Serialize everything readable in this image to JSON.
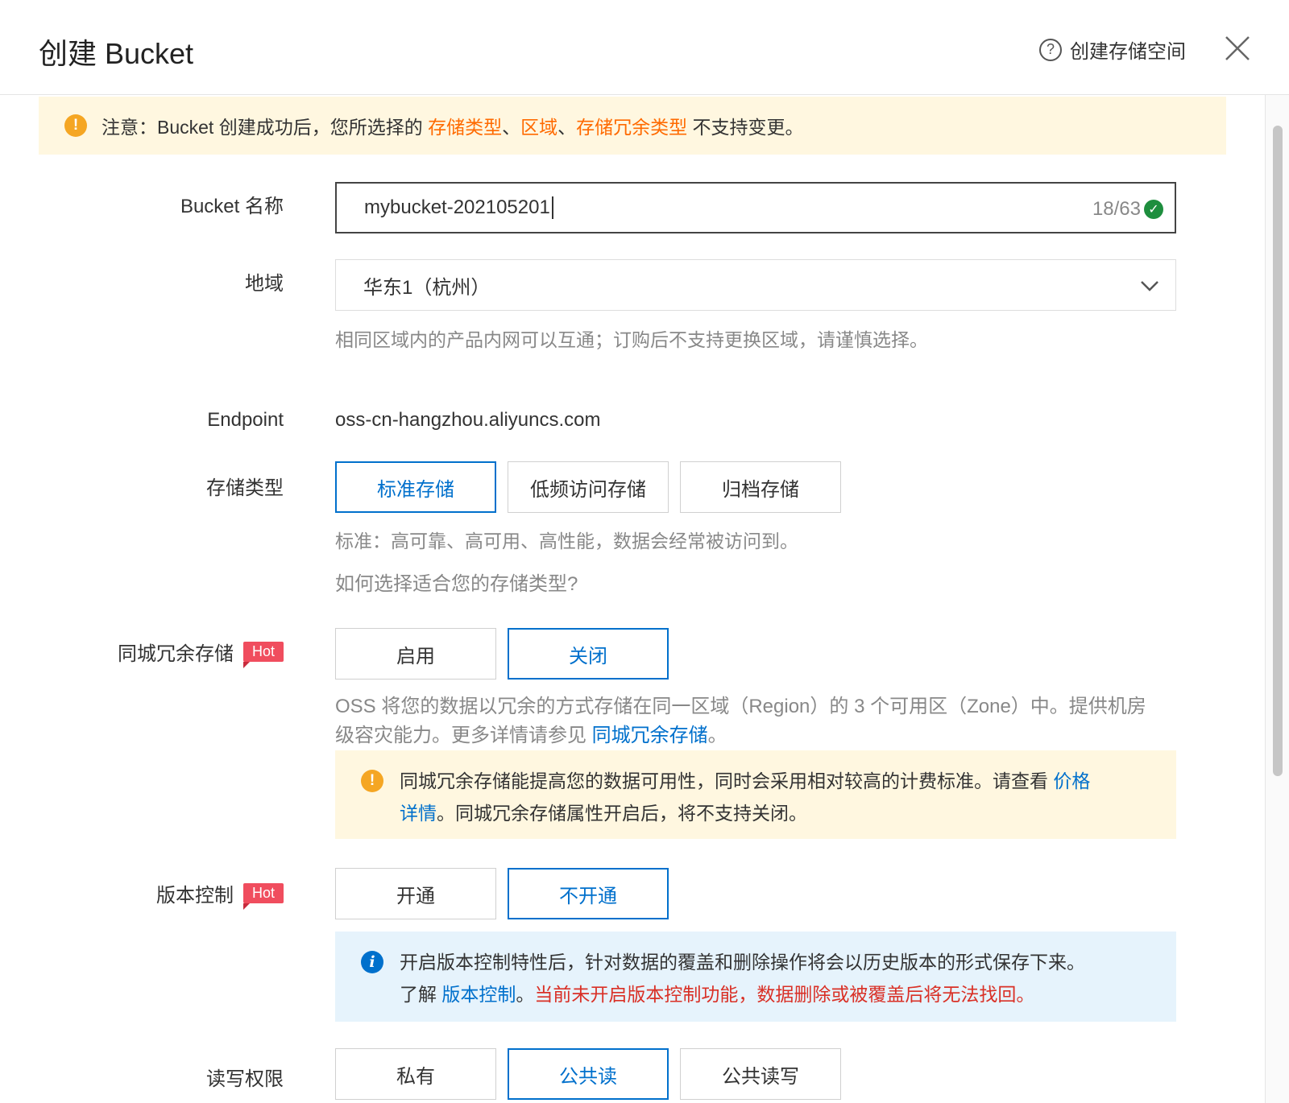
{
  "header": {
    "title": "创建 Bucket",
    "help_label": "创建存储空间"
  },
  "notice": {
    "prefix": "注意：Bucket 创建成功后，您所选择的 ",
    "item1": "存储类型",
    "sep1": "、",
    "item2": "区域",
    "sep2": "、",
    "item3": "存储冗余类型",
    "suffix": " 不支持变更。"
  },
  "bucket_name": {
    "label": "Bucket 名称",
    "value": "mybucket-202105201",
    "counter": "18/63"
  },
  "region": {
    "label": "地域",
    "value": "华东1（杭州）",
    "hint": "相同区域内的产品内网可以互通；订购后不支持更换区域，请谨慎选择。"
  },
  "endpoint": {
    "label": "Endpoint",
    "value": "oss-cn-hangzhou.aliyuncs.com"
  },
  "storage_class": {
    "label": "存储类型",
    "options": [
      "标准存储",
      "低频访问存储",
      "归档存储"
    ],
    "selected": "标准存储",
    "hint": "标准：高可靠、高可用、高性能，数据会经常被访问到。",
    "link": "如何选择适合您的存储类型?"
  },
  "zone_redundant": {
    "label": "同城冗余存储",
    "badge": "Hot",
    "options": [
      "启用",
      "关闭"
    ],
    "selected": "关闭",
    "hint_line1": "OSS 将您的数据以冗余的方式存储在同一区域（Region）的 3 个可用区（Zone）中。提供机房",
    "hint_line2": "级容灾能力。更多详情请参见 ",
    "hint_link": "同城冗余存储",
    "hint_end": "。",
    "alert_text1": "同城冗余存储能提高您的数据可用性，同时会采用相对较高的计费标准。请查看 ",
    "alert_link_a": "价格",
    "alert_link_b": "详情",
    "alert_text2": "。同城冗余存储属性开启后，将不支持关闭。"
  },
  "versioning": {
    "label": "版本控制",
    "badge": "Hot",
    "options": [
      "开通",
      "不开通"
    ],
    "selected": "不开通",
    "info_line1": "开启版本控制特性后，针对数据的覆盖和删除操作将会以历史版本的形式保存下来。",
    "info_prefix": "了解 ",
    "info_link": "版本控制",
    "info_dot": "。",
    "info_warning": "当前未开启版本控制功能，数据删除或被覆盖后将无法找回。"
  },
  "acl": {
    "label": "读写权限",
    "options": [
      "私有",
      "公共读",
      "公共读写"
    ],
    "selected": "公共读"
  },
  "colors": {
    "accent": "#0070cc",
    "warning": "#ff6a00",
    "danger": "#d93026",
    "hot": "#f04d5e"
  }
}
